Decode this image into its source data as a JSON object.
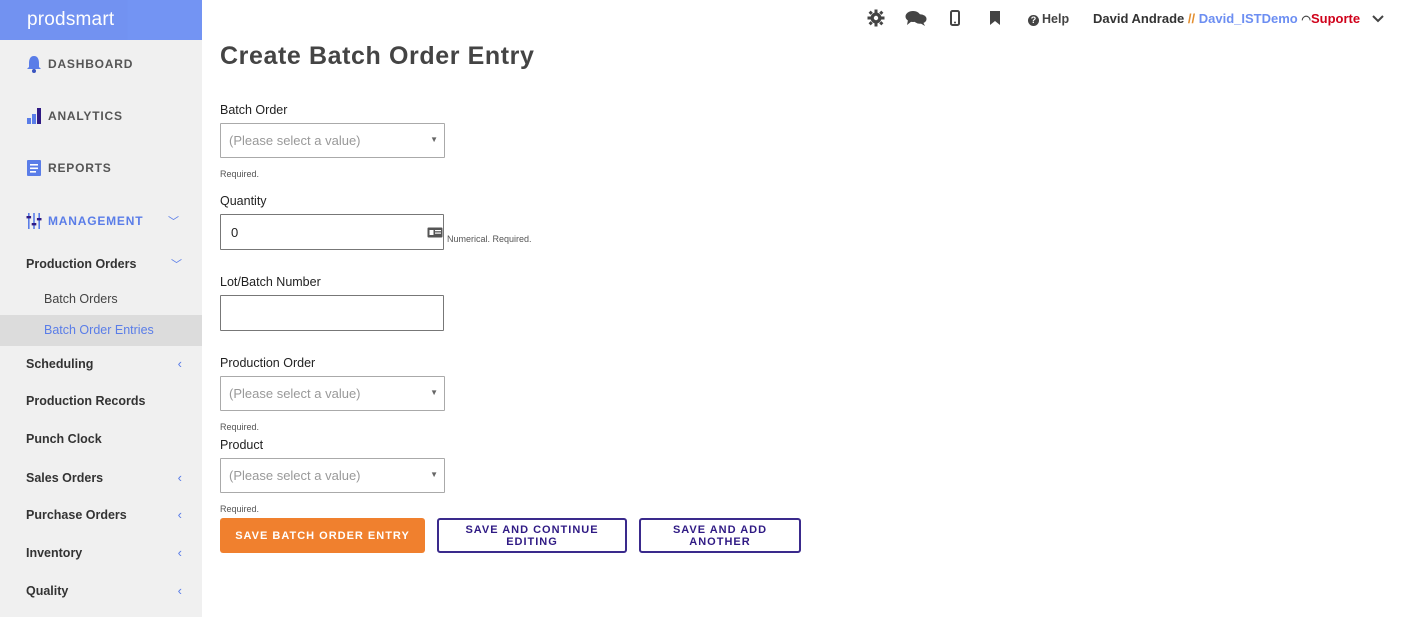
{
  "app": {
    "logo": "prodsmart"
  },
  "sidebar": {
    "main": [
      {
        "label": "DASHBOARD"
      },
      {
        "label": "ANALYTICS"
      },
      {
        "label": "REPORTS"
      },
      {
        "label": "MANAGEMENT"
      }
    ],
    "sections": [
      {
        "label": "Production Orders",
        "chevron": "﹀"
      },
      {
        "label": "Scheduling",
        "chevron": "‹"
      },
      {
        "label": "Production Records",
        "chevron": ""
      },
      {
        "label": "Punch Clock",
        "chevron": ""
      },
      {
        "label": "Sales Orders",
        "chevron": "‹"
      },
      {
        "label": "Purchase Orders",
        "chevron": "‹"
      },
      {
        "label": "Inventory",
        "chevron": "‹"
      },
      {
        "label": "Quality",
        "chevron": "‹"
      }
    ],
    "leaves": [
      {
        "label": "Batch Orders"
      },
      {
        "label": "Batch Order Entries"
      }
    ],
    "management_chevron": "﹀"
  },
  "topbar": {
    "icons": [
      "gear-icon",
      "chat-icon",
      "mobile-icon",
      "bookmark-icon"
    ],
    "help": "Help",
    "user_name": "David Andrade",
    "separator": "//",
    "account": "David_ISTDemo",
    "support": "Suporte"
  },
  "form": {
    "title": "Create Batch Order Entry",
    "batch_order": {
      "label": "Batch Order",
      "placeholder": "(Please select a value)",
      "help": "Required."
    },
    "quantity": {
      "label": "Quantity",
      "value": "0",
      "help": "Numerical. Required."
    },
    "lot": {
      "label": "Lot/Batch Number",
      "value": ""
    },
    "production_order": {
      "label": "Production Order",
      "placeholder": "(Please select a value)",
      "help": "Required."
    },
    "product": {
      "label": "Product",
      "placeholder": "(Please select a value)",
      "help": "Required."
    }
  },
  "actions": {
    "save": "SAVE BATCH ORDER ENTRY",
    "save_continue": "SAVE AND CONTINUE EDITING",
    "save_add": "SAVE AND ADD ANOTHER"
  },
  "colors": {
    "accent": "#6c8ef2",
    "primary_button": "#f0802e",
    "secondary_border": "#3a2a8c",
    "support": "#d0021b"
  }
}
